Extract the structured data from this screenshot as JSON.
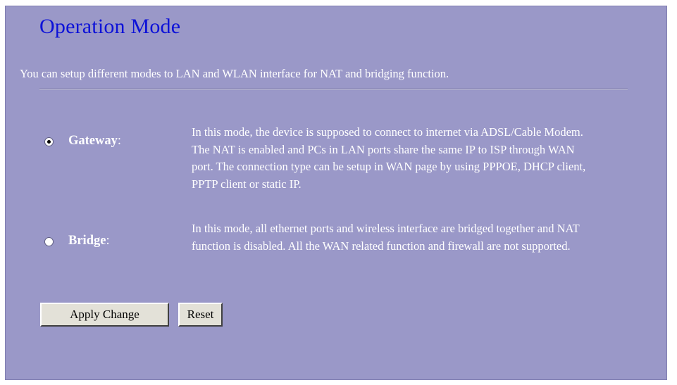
{
  "page": {
    "title": "Operation Mode",
    "description": "You can setup different modes to LAN and WLAN interface for NAT and bridging function."
  },
  "modes": [
    {
      "label": "Gateway",
      "checked": true,
      "lines": [
        "In this mode, the device is supposed to connect to internet via ADSL/Cable Modem.",
        "The NAT is enabled and PCs in LAN ports share the same IP to ISP through WAN",
        "port. The connection type can be setup in WAN page by using PPPOE, DHCP client,",
        "PPTP client or static IP."
      ]
    },
    {
      "label": "Bridge",
      "checked": false,
      "lines": [
        "In this mode, all ethernet ports and wireless interface are bridged together and NAT",
        "function is disabled. All the WAN related function and firewall are not supported."
      ]
    }
  ],
  "buttons": {
    "apply_label": "Apply Change",
    "reset_label": "Reset"
  },
  "colors": {
    "background": "#9a98c8",
    "title": "#0d12d8",
    "text": "#ffffff"
  }
}
